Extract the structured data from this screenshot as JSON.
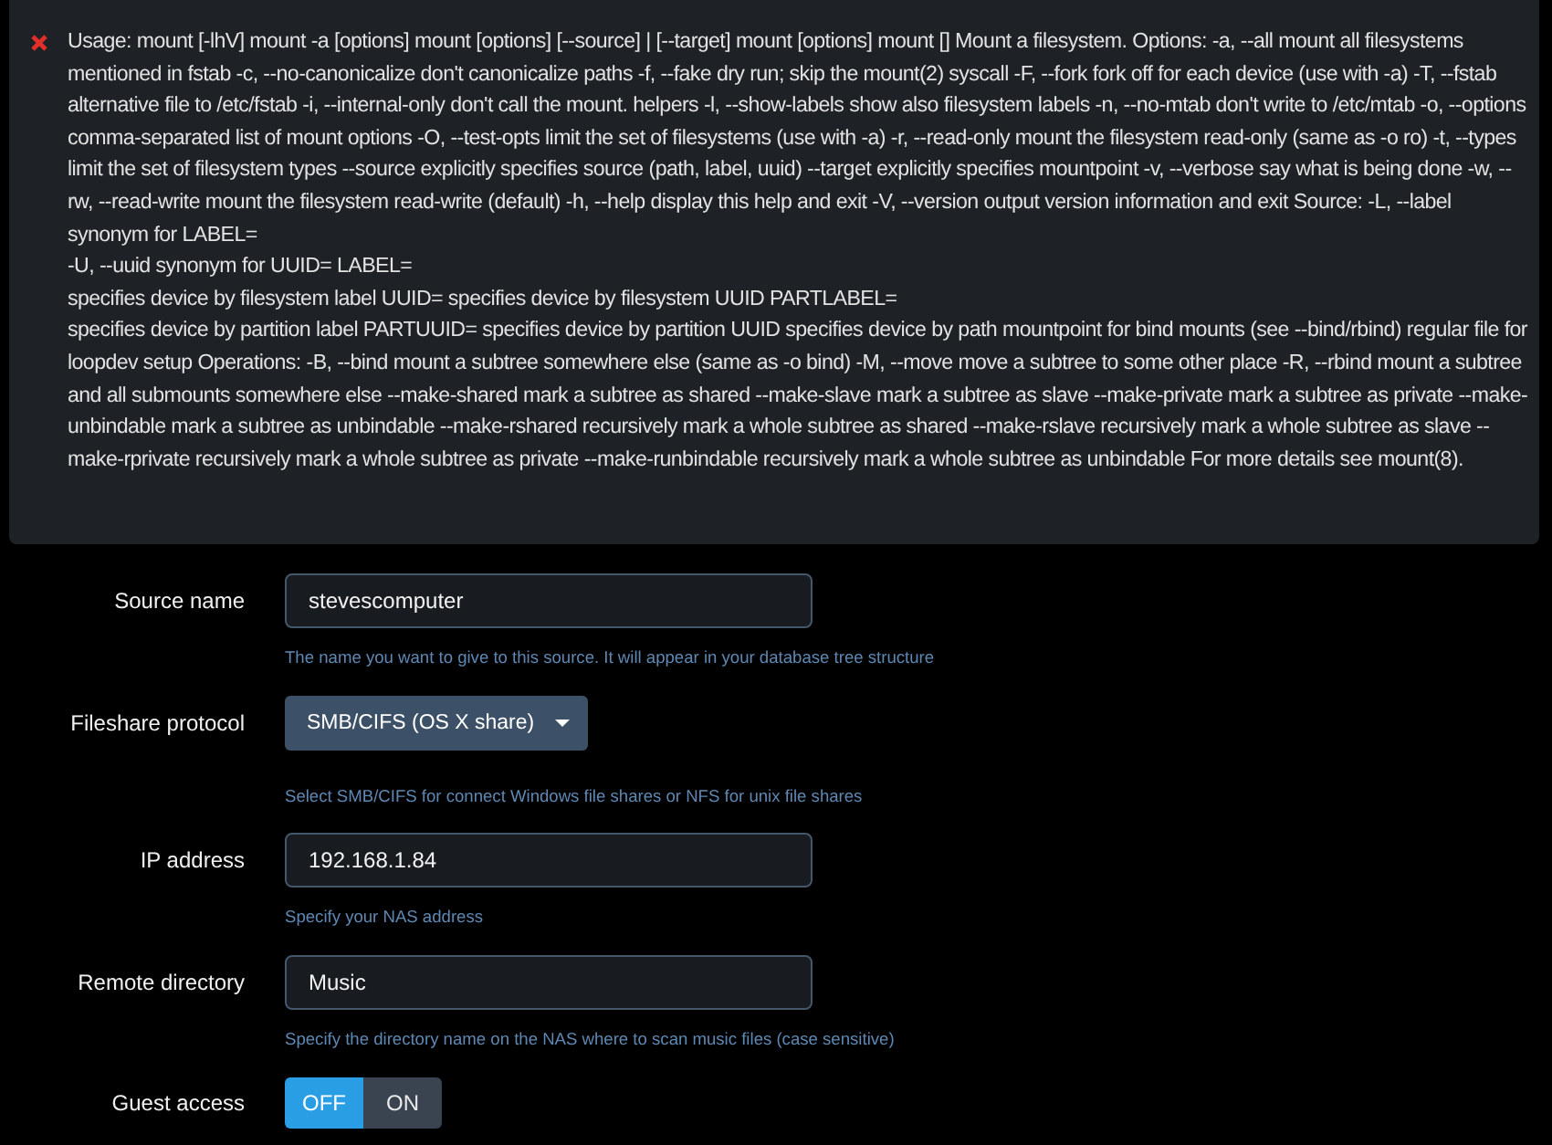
{
  "error": {
    "message": "Usage: mount [-lhV] mount -a [options] mount [options] [--source] | [--target] mount [options] mount [] Mount a filesystem. Options: -a, --all mount all filesystems mentioned in fstab -c, --no-canonicalize don't canonicalize paths -f, --fake dry run; skip the mount(2) syscall -F, --fork fork off for each device (use with -a) -T, --fstab alternative file to /etc/fstab -i, --internal-only don't call the mount. helpers -l, --show-labels show also filesystem labels -n, --no-mtab don't write to /etc/mtab -o, --options comma-separated list of mount options -O, --test-opts limit the set of filesystems (use with -a) -r, --read-only mount the filesystem read-only (same as -o ro) -t, --types limit the set of filesystem types --source explicitly specifies source (path, label, uuid) --target explicitly specifies mountpoint -v, --verbose say what is being done -w, --rw, --read-write mount the filesystem read-write (default) -h, --help display this help and exit -V, --version output version information and exit Source: -L, --label\nsynonym for LABEL=\n-U, --uuid synonym for UUID= LABEL=\nspecifies device by filesystem label UUID= specifies device by filesystem UUID PARTLABEL=\nspecifies device by partition label PARTUUID= specifies device by partition UUID specifies device by path mountpoint for bind mounts (see --bind/rbind) regular file for loopdev setup Operations: -B, --bind mount a subtree somewhere else (same as -o bind) -M, --move move a subtree to some other place -R, --rbind mount a subtree and all submounts somewhere else --make-shared mark a subtree as shared --make-slave mark a subtree as slave --make-private mark a subtree as private --make-unbindable mark a subtree as unbindable --make-rshared recursively mark a whole subtree as shared --make-rslave recursively mark a whole subtree as slave --make-rprivate recursively mark a whole subtree as private --make-runbindable recursively mark a whole subtree as unbindable For more details see mount(8)."
  },
  "fields": [
    {
      "kind": "text",
      "label": "Source name",
      "value": "stevescomputer",
      "hint": "The name you want to give to this source. It will appear in your database tree structure"
    },
    {
      "kind": "select",
      "label": "Fileshare protocol",
      "value": "SMB/CIFS (OS X share)",
      "hint": "Select SMB/CIFS for connect Windows file shares or NFS for unix file shares"
    },
    {
      "kind": "text",
      "label": "IP address",
      "value": "192.168.1.84",
      "hint": "Specify your NAS address"
    },
    {
      "kind": "text",
      "label": "Remote directory",
      "value": "Music",
      "hint": "Specify the directory name on the NAS where to scan music files (case sensitive)"
    },
    {
      "kind": "toggle",
      "label": "Guest access",
      "options": [
        {
          "label": "OFF",
          "selected": true
        },
        {
          "label": "ON",
          "selected": false
        }
      ]
    }
  ]
}
